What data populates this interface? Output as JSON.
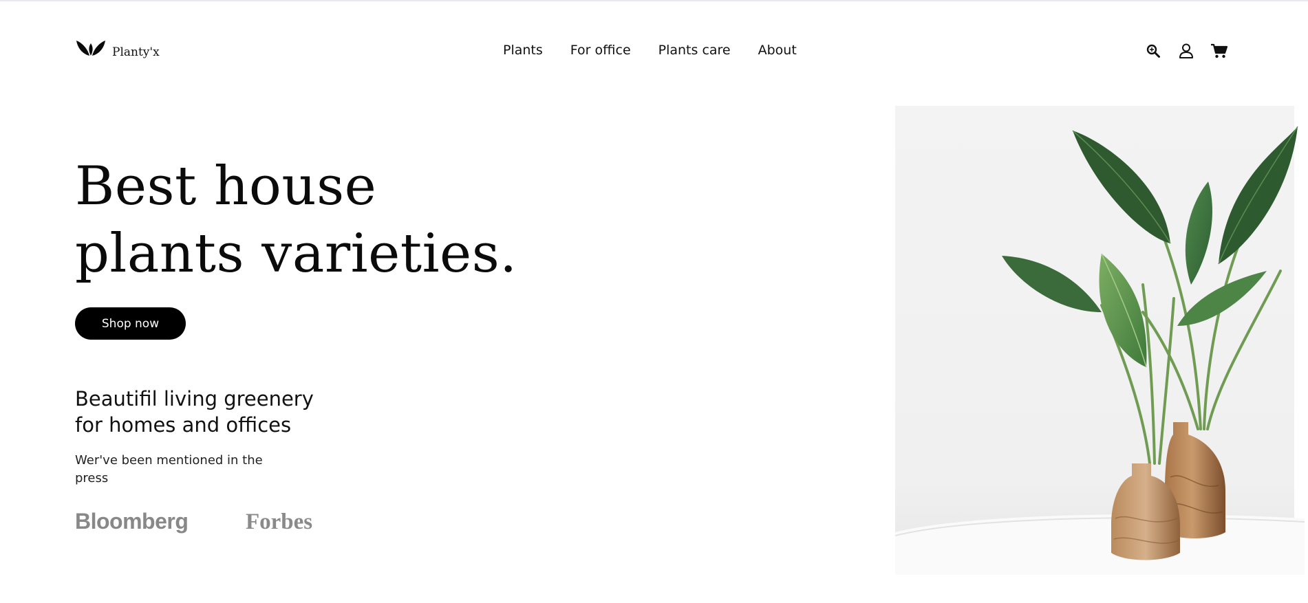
{
  "brand": {
    "name": "Planty'x",
    "logo_icon": "leaf-logo-icon"
  },
  "nav": {
    "items": [
      {
        "label": "Plants"
      },
      {
        "label": "For office"
      },
      {
        "label": "Plants care"
      },
      {
        "label": "About"
      }
    ]
  },
  "header_icons": {
    "search": "search-icon",
    "account": "user-icon",
    "cart": "cart-icon"
  },
  "hero": {
    "title_line1": "Best house",
    "title_line2": "plants varieties.",
    "cta_label": "Shop now",
    "tagline_line1": "Beautifil living greenery",
    "tagline_line2": "for homes and offices",
    "press_text": "Wer've been mentioned in the press",
    "press_logos": [
      "Bloomberg",
      "Forbes"
    ],
    "image_subject": "Two wooden vases with green plants"
  },
  "colors": {
    "text": "#111111",
    "button_bg": "#000000",
    "button_text": "#ffffff",
    "press_logo": "#888888",
    "top_rule": "#e9e8f1"
  }
}
